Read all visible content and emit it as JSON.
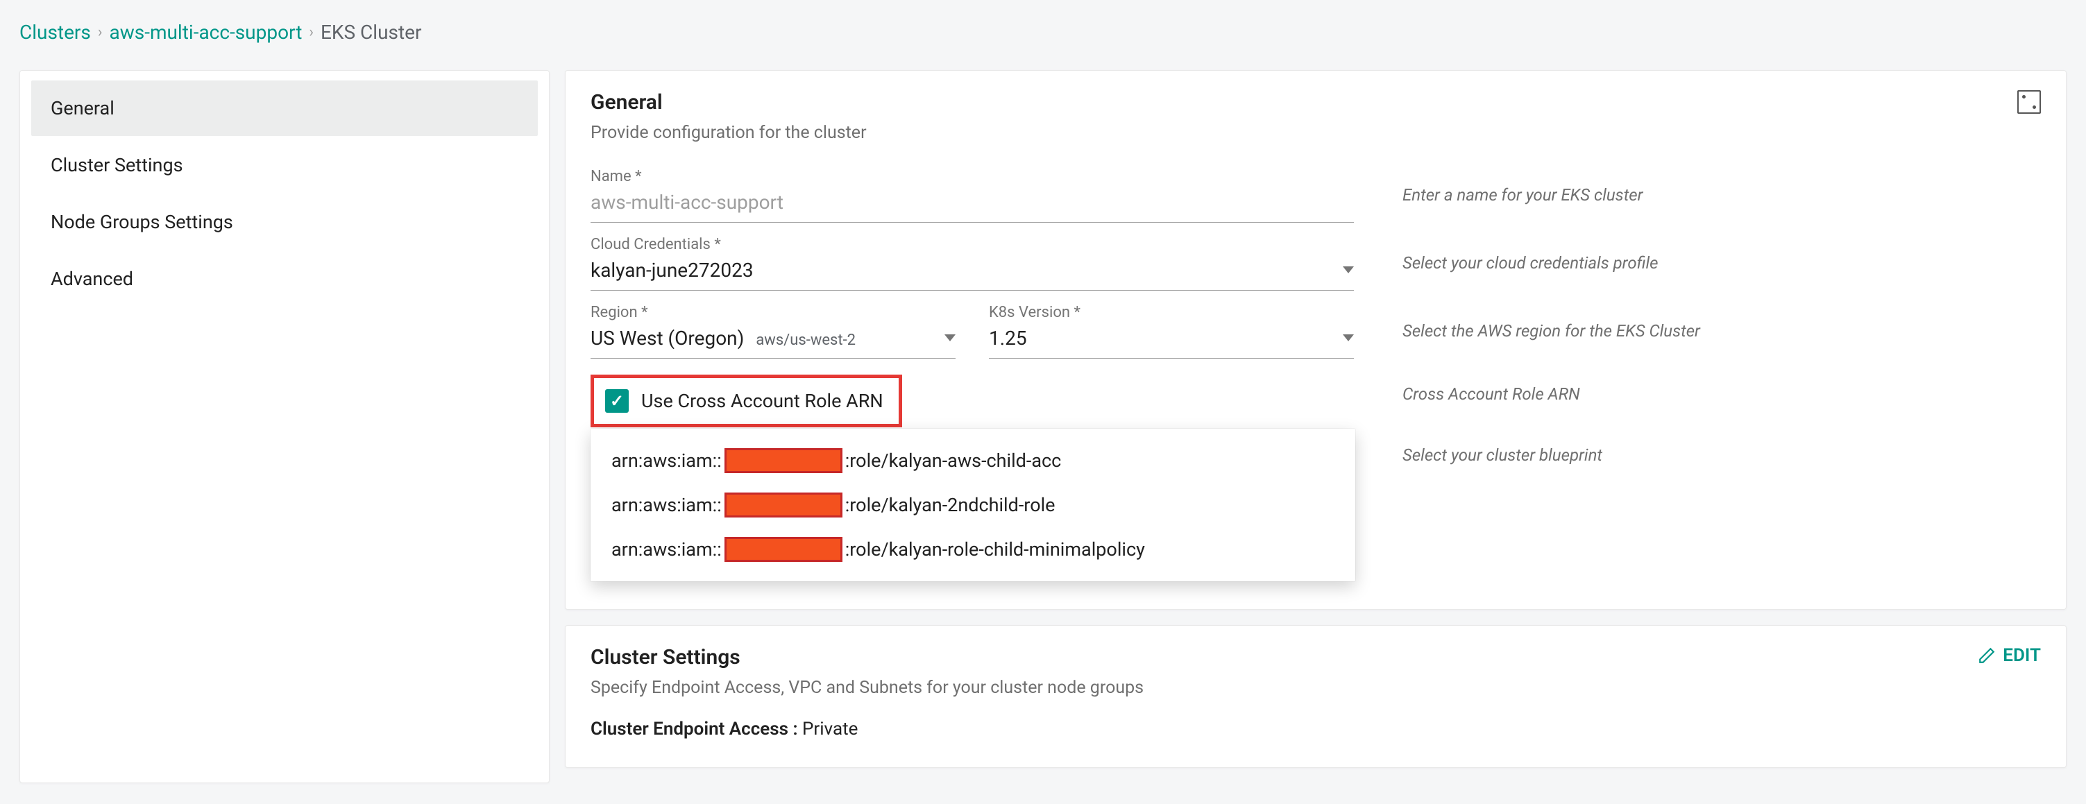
{
  "breadcrumb": {
    "root": "Clusters",
    "mid": "aws-multi-acc-support",
    "current": "EKS Cluster"
  },
  "sidebar": {
    "items": [
      {
        "label": "General",
        "active": true
      },
      {
        "label": "Cluster Settings",
        "active": false
      },
      {
        "label": "Node Groups Settings",
        "active": false
      },
      {
        "label": "Advanced",
        "active": false
      }
    ]
  },
  "general": {
    "title": "General",
    "subtitle": "Provide configuration for the cluster",
    "name_label": "Name *",
    "name_value": "aws-multi-acc-support",
    "name_hint": "Enter a name for your EKS cluster",
    "cred_label": "Cloud Credentials *",
    "cred_value": "kalyan-june272023",
    "cred_hint": "Select your cloud credentials profile",
    "region_label": "Region *",
    "region_value": "US West (Oregon)",
    "region_code": "aws/us-west-2",
    "k8s_label": "K8s Version *",
    "k8s_value": "1.25",
    "region_hint": "Select the AWS region for the EKS Cluster",
    "cross_label": "Use Cross Account Role ARN",
    "arn_hint": "Cross Account Role ARN",
    "blueprint_hint": "Select your cluster blueprint",
    "arn_options": [
      {
        "prefix": "arn:aws:iam::",
        "suffix": ":role/kalyan-aws-child-acc"
      },
      {
        "prefix": "arn:aws:iam::",
        "suffix": ":role/kalyan-2ndchild-role"
      },
      {
        "prefix": "arn:aws:iam::",
        "suffix": ":role/kalyan-role-child-minimalpolicy"
      }
    ]
  },
  "cluster_settings": {
    "title": "Cluster Settings",
    "subtitle": "Specify Endpoint Access, VPC and Subnets for your cluster node groups",
    "edit": "EDIT",
    "endpoint_label": "Cluster Endpoint Access :",
    "endpoint_value": "Private"
  }
}
